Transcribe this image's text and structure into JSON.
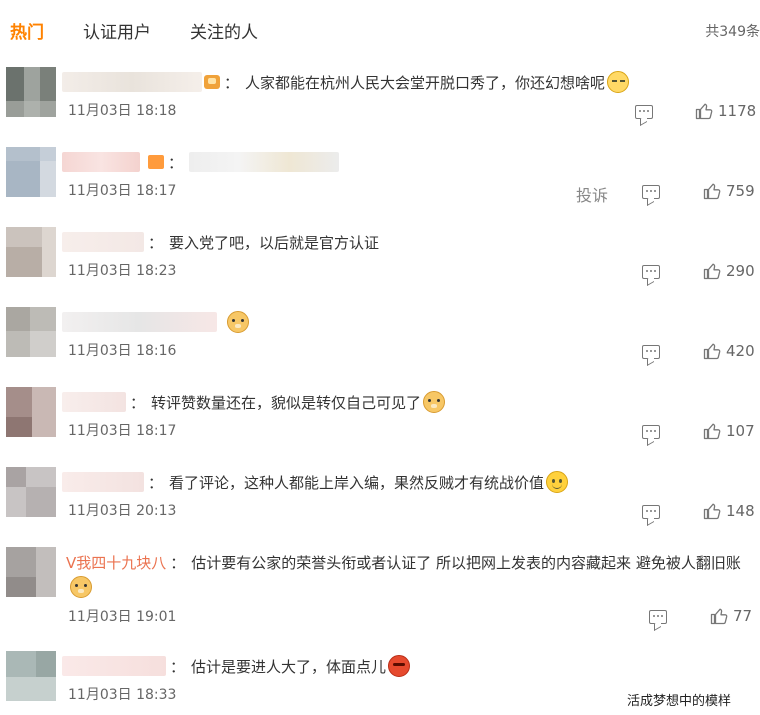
{
  "tabs": {
    "hot": "热门",
    "verified": "认证用户",
    "following": "关注的人",
    "total": "共349条"
  },
  "comments": [
    {
      "text": "人家都能在杭州人民大会堂开脱口秀了，你还幻想啥呢",
      "time": "11月03日 18:18",
      "likes": "1178"
    },
    {
      "text": "",
      "time": "11月03日 18:17",
      "likes": "759",
      "report": "投诉"
    },
    {
      "text": "要入党了吧，以后就是官方认证",
      "time": "11月03日 18:23",
      "likes": "290"
    },
    {
      "text": "",
      "time": "11月03日 18:16",
      "likes": "420"
    },
    {
      "text": "转评赞数量还在，貌似是转仅自己可见了",
      "time": "11月03日 18:17",
      "likes": "107"
    },
    {
      "text": "看了评论，这种人都能上岸入编，果然反贼才有统战价值",
      "time": "11月03日 20:13",
      "likes": "148"
    },
    {
      "name": "V我四十九块八",
      "text": "估计要有公家的荣誉头衔或者认证了 所以把网上发表的内容藏起来 避免被人翻旧账",
      "time": "11月03日 19:01",
      "likes": "77"
    },
    {
      "text": "估计是要进人大了，体面点儿",
      "time": "11月03日 18:33"
    }
  ],
  "watermark": "活成梦想中的模样",
  "icons": {
    "reply": "comment-icon",
    "like": "thumbs-up-icon"
  },
  "colors": {
    "accent": "#ff8200",
    "name": "#eb7350"
  }
}
